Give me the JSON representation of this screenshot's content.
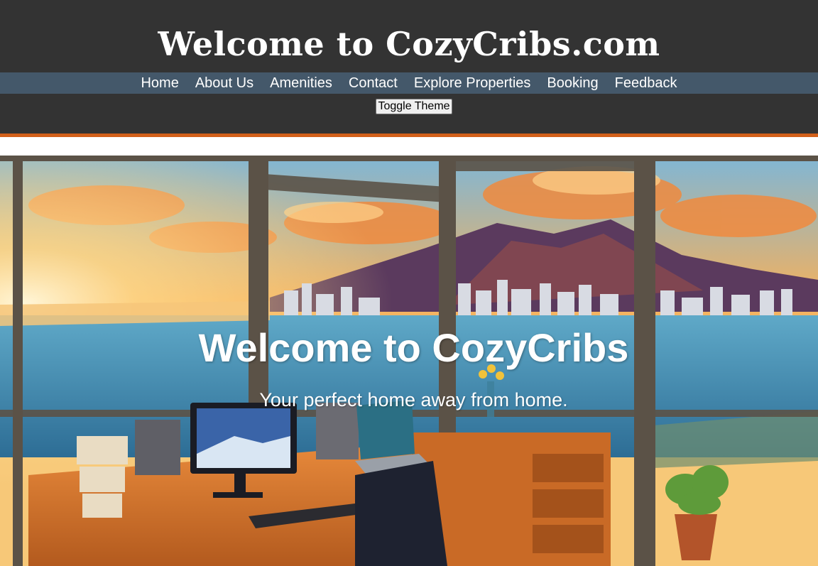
{
  "header": {
    "title": "Welcome to CozyCribs.com",
    "background_color": "#333333",
    "accent_color": "#d2601a"
  },
  "nav": {
    "background_color": "#44586a",
    "items": [
      {
        "label": "Home"
      },
      {
        "label": "About Us"
      },
      {
        "label": "Amenities"
      },
      {
        "label": "Contact"
      },
      {
        "label": "Explore Properties"
      },
      {
        "label": "Booking"
      },
      {
        "label": "Feedback"
      }
    ]
  },
  "theme_toggle": {
    "label": "Toggle Theme"
  },
  "hero": {
    "title": "Welcome to CozyCribs",
    "subtitle": "Your perfect home away from home.",
    "image_icon": "office-window-sunset-illustration"
  }
}
